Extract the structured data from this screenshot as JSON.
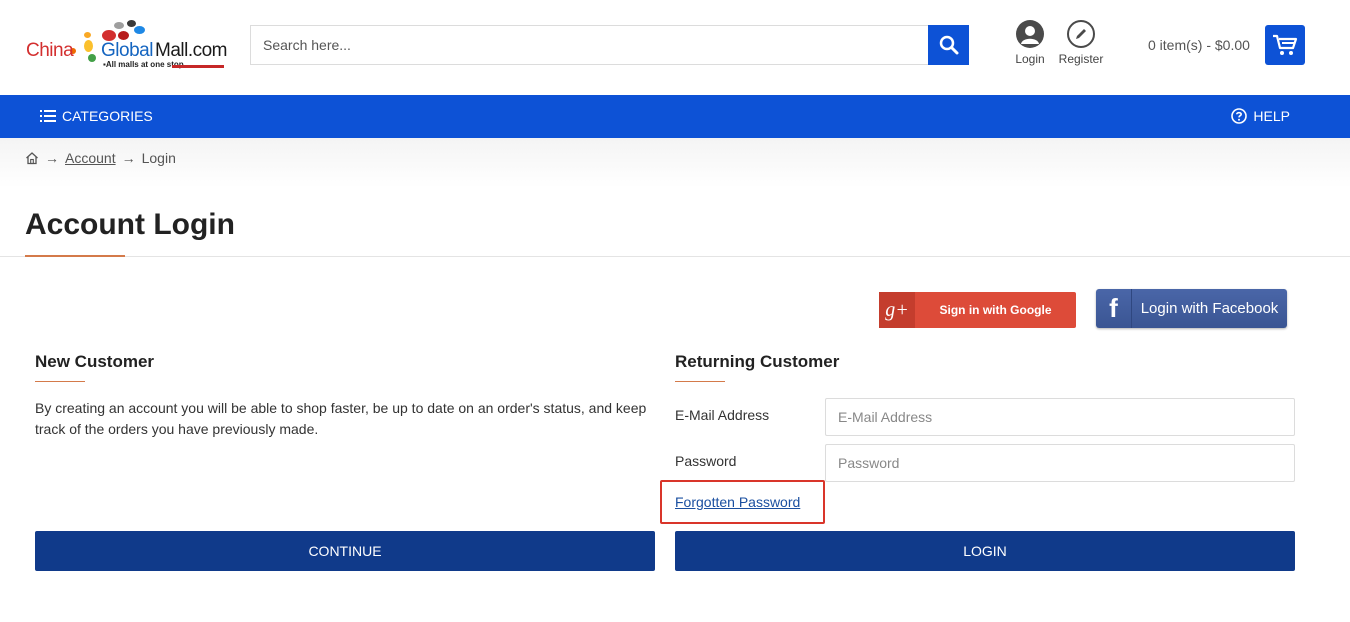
{
  "header": {
    "logo": {
      "part1": "China",
      "part2": "Global",
      "part3": "Mall.com",
      "tagline": "All malls at one stop"
    },
    "search": {
      "placeholder": "Search here..."
    },
    "login_label": "Login",
    "register_label": "Register",
    "cart_summary": "0 item(s) - $0.00"
  },
  "nav": {
    "categories_label": "CATEGORIES",
    "help_label": "HELP"
  },
  "breadcrumb": {
    "arrow": "→",
    "items": [
      "Account",
      "Login"
    ]
  },
  "page": {
    "title": "Account Login"
  },
  "social": {
    "google_label": "Sign in with Google",
    "facebook_label": "Login with Facebook"
  },
  "new_customer": {
    "heading": "New Customer",
    "description": "By creating an account you will be able to shop faster, be up to date on an order's status, and keep track of the orders you have previously made.",
    "continue_label": "CONTINUE"
  },
  "returning_customer": {
    "heading": "Returning Customer",
    "email_label": "E-Mail Address",
    "email_placeholder": "E-Mail Address",
    "password_label": "Password",
    "password_placeholder": "Password",
    "forgotten_label": "Forgotten Password",
    "login_label": "LOGIN"
  },
  "colors": {
    "primary_blue": "#0d52d6",
    "button_navy": "#103a8a",
    "accent_underline": "#d47a4a",
    "highlight_red": "#d9352a",
    "google_red": "#dd4b39",
    "facebook_blue": "#3b5998"
  }
}
